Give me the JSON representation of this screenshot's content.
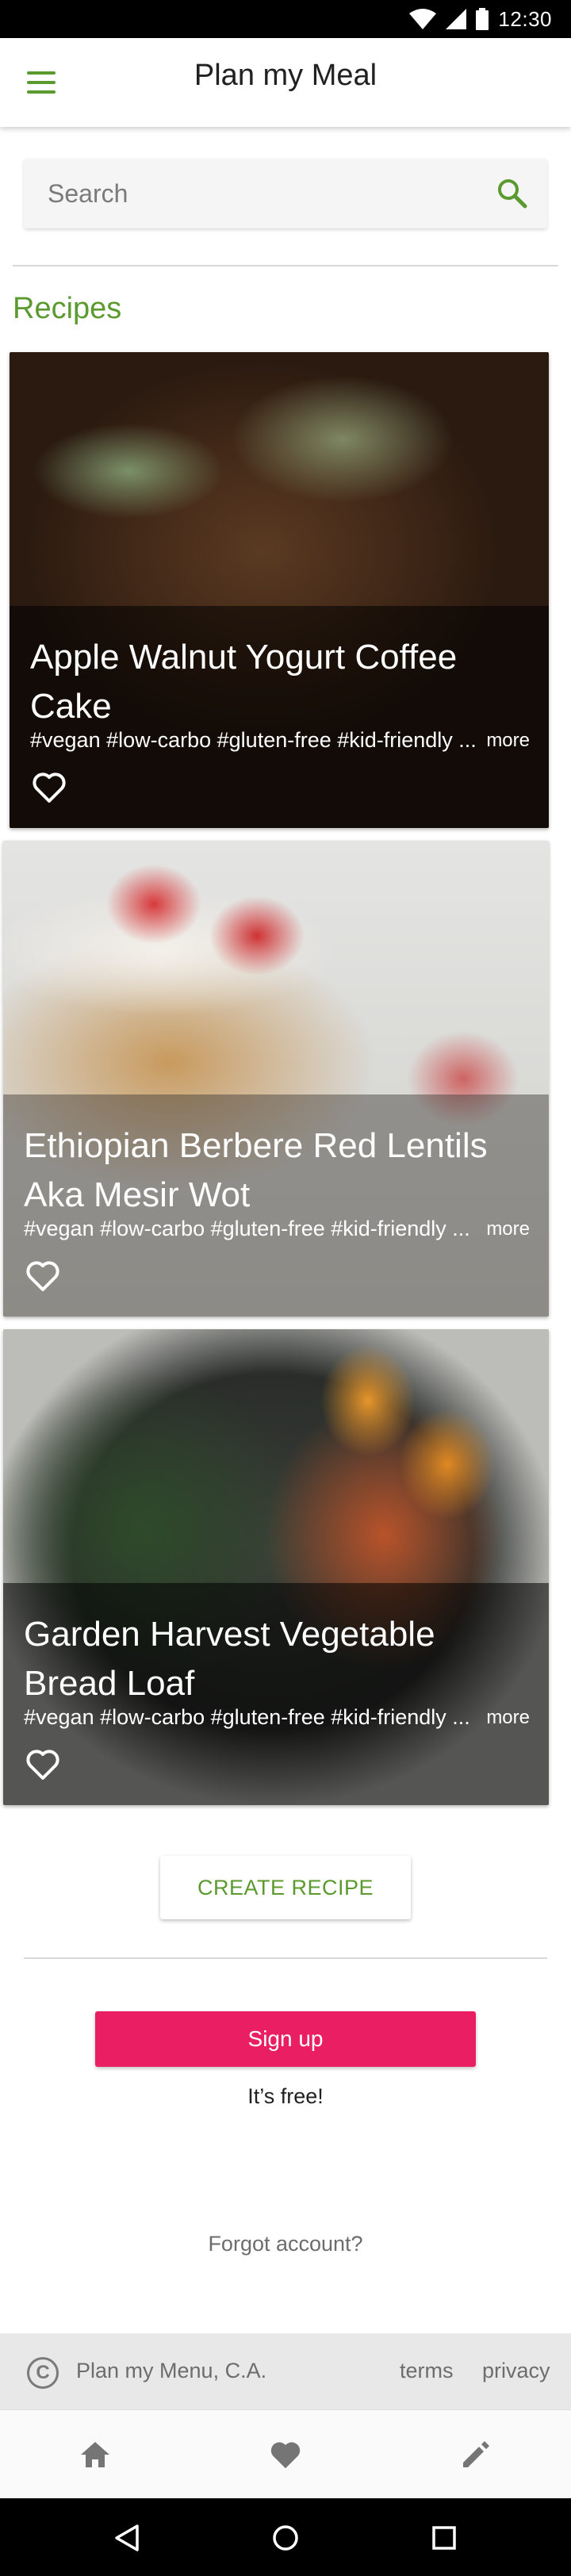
{
  "status_bar": {
    "time": "12:30"
  },
  "app_bar": {
    "title": "Plan my Meal"
  },
  "search": {
    "placeholder": "Search"
  },
  "recipes_section": {
    "title": "Recipes"
  },
  "recipes": [
    {
      "title": "Apple Walnut Yogurt Coffee Cake",
      "tags": "#vegan #low-carbo #gluten-free #kid-friendly ...",
      "more": "more"
    },
    {
      "title": "Ethiopian Berbere Red Lentils Aka Mesir Wot",
      "tags": "#vegan #low-carbo #gluten-free #kid-friendly ...",
      "more": "more"
    },
    {
      "title": "Garden Harvest Vegetable Bread Loaf",
      "tags": "#vegan #low-carbo #gluten-free #kid-friendly ...",
      "more": "more"
    }
  ],
  "actions": {
    "create_recipe": "CREATE RECIPE",
    "sign_up": "Sign up",
    "free_note": "It’s free!",
    "forgot_account": "Forgot account?"
  },
  "footer": {
    "company": "Plan my Menu, C.A.",
    "terms": "terms",
    "privacy": "privacy"
  },
  "colors": {
    "accent_green": "#5a9a2e",
    "signup_pink": "#e91e63"
  },
  "icons": {
    "menu": "menu-icon",
    "search": "search-icon",
    "favorite": "heart-outline-icon",
    "nav_home": "home-icon",
    "nav_favorites": "heart-icon",
    "nav_edit": "pencil-icon"
  }
}
